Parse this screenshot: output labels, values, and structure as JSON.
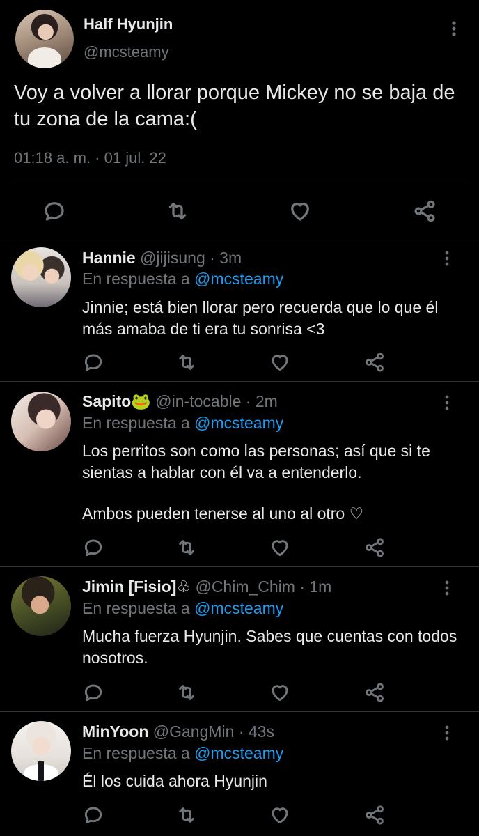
{
  "main_tweet": {
    "author_name": "Half Hyunjin",
    "author_handle": "@mcsteamy",
    "text": "Voy a volver a llorar porque Mickey no se baja de tu zona de la cama:(",
    "timestamp": "01:18 a. m. · 01 jul. 22"
  },
  "replies": [
    {
      "name": "Hannie",
      "handle_time": " @jijisung · 3m",
      "replying_prefix": "En respuesta a ",
      "mention": "@mcsteamy",
      "text": "Jinnie;  está bien llorar pero recuerda que lo que él más amaba de ti era tu sonrisa <3"
    },
    {
      "name": "Sapito🐸",
      "handle_time": " @in-tocable · 2m",
      "replying_prefix": "En respuesta a ",
      "mention": "@mcsteamy",
      "text_p1": "Los perritos son como las personas; así que si te sientas a hablar con él va a entenderlo.",
      "text_p2": "Ambos pueden tenerse al uno al otro ♡"
    },
    {
      "name": "Jimin [Fisio]♧",
      "handle_time": " @Chim_Chim · 1m",
      "replying_prefix": "En respuesta a ",
      "mention": "@mcsteamy",
      "text": "Mucha fuerza Hyunjin. Sabes que cuentas con todos nosotros."
    },
    {
      "name": "MinYoon",
      "handle_time": " @GangMin · 43s",
      "replying_prefix": "En respuesta a ",
      "mention": "@mcsteamy",
      "text": "Él los cuida ahora Hyunjin"
    }
  ],
  "icons": {
    "reply": "reply-icon",
    "retweet": "retweet-icon",
    "like": "like-icon",
    "share": "share-icon",
    "more": "more-icon"
  },
  "colors": {
    "background": "#000000",
    "text": "#e7e9ea",
    "secondary": "#71767b",
    "accent": "#1d9bf0",
    "divider": "#2f3336"
  }
}
